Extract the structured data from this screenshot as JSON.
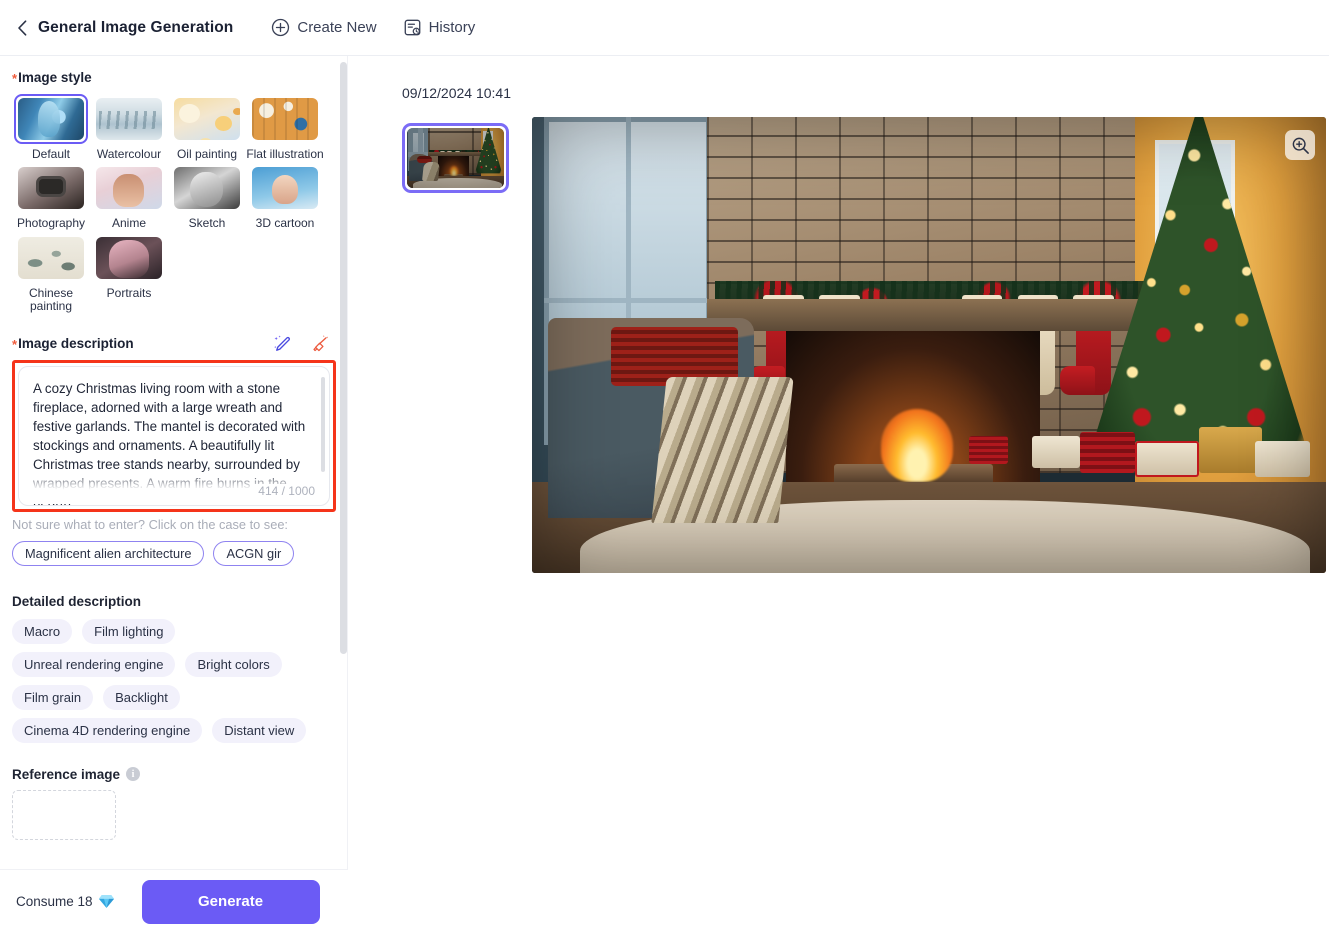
{
  "header": {
    "back_icon": "chevron-left-icon",
    "title": "General Image Generation",
    "actions": [
      {
        "icon": "plus-circle-icon",
        "label": "Create New"
      },
      {
        "icon": "history-icon",
        "label": "History"
      }
    ]
  },
  "left": {
    "image_style": {
      "required": "*",
      "label": "Image style",
      "selected": "Default",
      "options": [
        {
          "label": "Default",
          "art": "art-default"
        },
        {
          "label": "Watercolour",
          "art": "art-water"
        },
        {
          "label": "Oil painting",
          "art": "art-oil"
        },
        {
          "label": "Flat illustration",
          "art": "art-flat"
        },
        {
          "label": "Photography",
          "art": "art-photo"
        },
        {
          "label": "Anime",
          "art": "art-anime"
        },
        {
          "label": "Sketch",
          "art": "art-sketch"
        },
        {
          "label": "3D cartoon",
          "art": "art-3d"
        },
        {
          "label": "Chinese painting",
          "art": "art-chinese"
        },
        {
          "label": "Portraits",
          "art": "art-portrait"
        }
      ]
    },
    "image_description": {
      "required": "*",
      "label": "Image description",
      "magic_icon": "magic-pen-icon",
      "clear_icon": "broom-icon",
      "value": "A cozy Christmas living room with a stone fireplace, adorned with a large wreath and festive garlands. The mantel is decorated with stockings and ornaments. A beautifully lit Christmas tree stands nearby, surrounded by wrapped presents. A warm fire burns in the hearth.",
      "counter": "414 / 1000",
      "hint": "Not sure what to enter? Click on the case to see:",
      "examples": [
        "Magnificent alien architecture",
        "ACGN gir"
      ]
    },
    "detailed_description": {
      "label": "Detailed description",
      "tags": [
        "Macro",
        "Film lighting",
        "Unreal rendering engine",
        "Bright colors",
        "Film grain",
        "Backlight",
        "Cinema 4D rendering engine",
        "Distant view"
      ]
    },
    "reference_image": {
      "label": "Reference image",
      "info_icon": "info-icon",
      "upload_icon": "upload-dashed-box"
    }
  },
  "footer": {
    "consume_label": "Consume 18",
    "gem_icon": "diamond-icon",
    "generate_label": "Generate"
  },
  "result": {
    "date": "09/12/2024 10:41",
    "thumbnail_alt": "christmas-living-room-thumbnail",
    "main_image_alt": "christmas-living-room-generated-image",
    "zoom_icon": "magnifier-plus-icon"
  },
  "colors": {
    "accent": "#6b5bf5",
    "accent_border": "#8f83f0",
    "required_star": "#f05c3c",
    "annotation": "#f5341a",
    "tag_bg": "#f2f1fb",
    "text": "#1f2433",
    "muted": "#a9adb8"
  }
}
